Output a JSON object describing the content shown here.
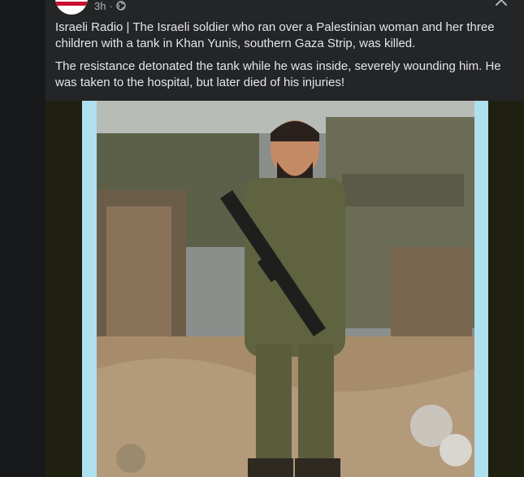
{
  "post": {
    "time": "3h",
    "separator": "·",
    "paragraphs": [
      "Israeli Radio |  The Israeli soldier who ran over a Palestinian woman and her three children with a tank in Khan Yunis, southern Gaza Strip, was killed.",
      "The resistance detonated the tank while he was inside, severely wounding him. He was taken to the hospital, but later died of his injuries!"
    ],
    "icons": {
      "audience": "globe-icon",
      "close": "close-icon"
    }
  },
  "colors": {
    "background": "#18191a",
    "card": "#242526",
    "text": "#e4e6eb",
    "meta": "#b0b3b8",
    "photo_frame": "#aee0f0"
  }
}
